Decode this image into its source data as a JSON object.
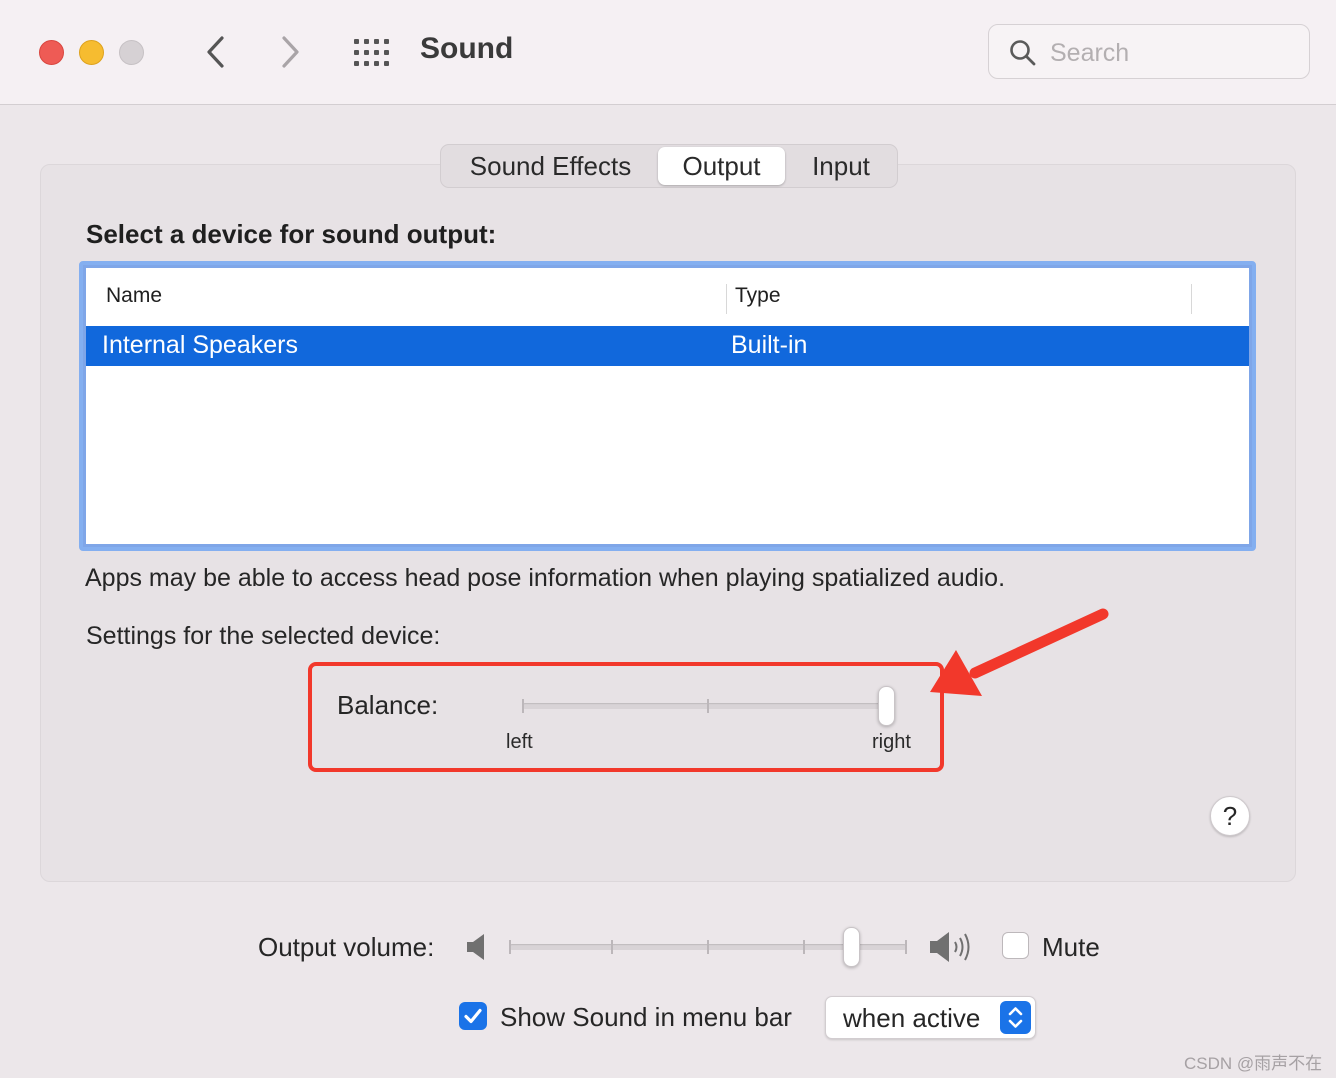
{
  "window": {
    "title": "Sound",
    "search_placeholder": "Search"
  },
  "tabs": [
    {
      "label": "Sound Effects",
      "selected": false
    },
    {
      "label": "Output",
      "selected": true
    },
    {
      "label": "Input",
      "selected": false
    }
  ],
  "output": {
    "heading": "Select a device for sound output:",
    "table": {
      "columns": [
        "Name",
        "Type"
      ],
      "rows": [
        {
          "name": "Internal Speakers",
          "type": "Built-in",
          "selected": true
        }
      ]
    },
    "info_text": "Apps may be able to access head pose information when playing spatialized audio.",
    "settings_label": "Settings for the selected device:",
    "balance": {
      "label": "Balance:",
      "left_label": "left",
      "right_label": "right",
      "value_fraction": 1.0
    }
  },
  "footer": {
    "volume_label": "Output volume:",
    "volume_fraction": 0.86,
    "mute_label": "Mute",
    "mute_checked": false,
    "show_in_menu_bar_label": "Show Sound in menu bar",
    "show_in_menu_bar_checked": true,
    "menu_bar_option": "when active"
  },
  "watermark": "CSDN @雨声不在",
  "colors": {
    "selection": "#1168dc",
    "accent": "#1a73e8",
    "annotation": "#f2382b"
  },
  "icons": [
    "search-icon",
    "chevron-left-icon",
    "chevron-right-icon",
    "grid-icon",
    "speaker-low-icon",
    "speaker-high-icon",
    "help-icon",
    "checkmark-icon",
    "updown-chevron-icon"
  ]
}
